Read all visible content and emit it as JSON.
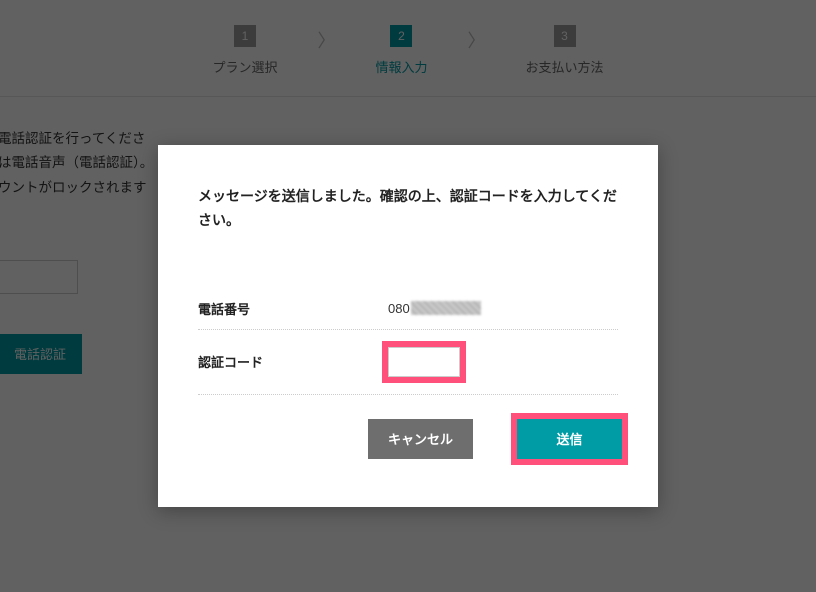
{
  "stepper": {
    "steps": [
      {
        "num": "1",
        "label": "プラン選択",
        "active": false
      },
      {
        "num": "2",
        "label": "情報入力",
        "active": true
      },
      {
        "num": "3",
        "label": "お支払い方法",
        "active": false
      }
    ]
  },
  "background": {
    "line1": "電話認証を行ってくださ",
    "line2": "は電話音声（電話認証）。",
    "line3": "ウントがロックされます",
    "button_label": "電話認証"
  },
  "modal": {
    "title": "メッセージを送信しました。確認の上、認証コードを入力してください。",
    "phone_label": "電話番号",
    "phone_value_visible": "080",
    "code_label": "認証コード",
    "code_value": "",
    "cancel_label": "キャンセル",
    "submit_label": "送信"
  },
  "colors": {
    "accent": "#009ca6",
    "highlight": "#ff4f7b",
    "overlay": "rgba(0,0,0,0.62)",
    "gray_btn": "#6e6e6e"
  }
}
